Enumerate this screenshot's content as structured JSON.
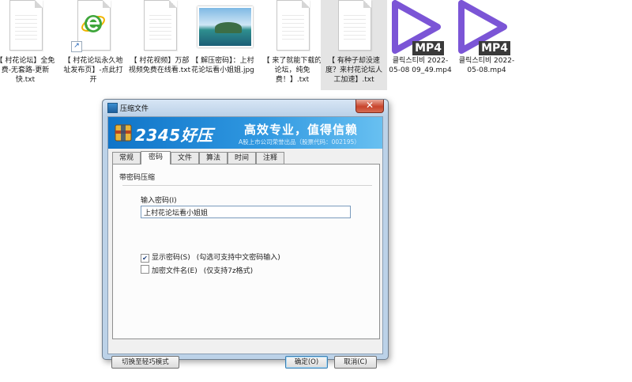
{
  "desktop": {
    "files": [
      {
        "label": "【 村花论坛】全免费-无套路-更新快.txt",
        "kind": "text"
      },
      {
        "label": "【 村花论坛永久地址发布页】-点此打开",
        "kind": "shortcut"
      },
      {
        "label": "【 村花视频】万部视频免费在线看.txt",
        "kind": "text"
      },
      {
        "label": "【 解压密码】：上村花论坛看小姐姐.jpg",
        "kind": "image"
      },
      {
        "label": "【 来了就能下载的论坛，纯免费！】.txt",
        "kind": "text"
      },
      {
        "label": "【 有种子却没速度？来村花论坛人工加速】.txt",
        "kind": "text",
        "selected": true
      },
      {
        "label": "클릭스티비 2022-05-08 09_49.mp4",
        "kind": "video"
      },
      {
        "label": "클릭스티비 2022-05-08.mp4",
        "kind": "video"
      }
    ],
    "video_badge": "MP4",
    "icons": {
      "text": "text-file-icon",
      "shortcut": "ie-shortcut-icon",
      "image": "image-file-icon",
      "video": "mp4-video-icon"
    }
  },
  "dialog": {
    "title": "压缩文件",
    "close_glyph": "✕",
    "banner": {
      "logo": "2345好压",
      "slogan": "高效专业，值得信赖",
      "subtitle": "A股上市公司荣誉出品（股票代码：002195）"
    },
    "tabs": [
      {
        "label": "常规",
        "active": false
      },
      {
        "label": "密码",
        "active": true
      },
      {
        "label": "文件",
        "active": false
      },
      {
        "label": "算法",
        "active": false
      },
      {
        "label": "时间",
        "active": false
      },
      {
        "label": "注释",
        "active": false
      }
    ],
    "group_title": "带密码压缩",
    "password_label": "输入密码(I)",
    "password_value": "上村花论坛看小姐姐",
    "show_password": {
      "label": "显示密码(S)",
      "checked": true,
      "hint": "(勾选可支持中文密码输入)"
    },
    "encrypt_names": {
      "label": "加密文件名(E)",
      "checked": false,
      "hint": "(仅支持7z格式)"
    },
    "buttons": {
      "switch_mode": "切换至轻巧模式",
      "ok": "确定(O)",
      "cancel": "取消(C)"
    },
    "colors": {
      "banner": "#1e86d6",
      "accent": "#3c7fb1",
      "close": "#c8442c"
    }
  }
}
